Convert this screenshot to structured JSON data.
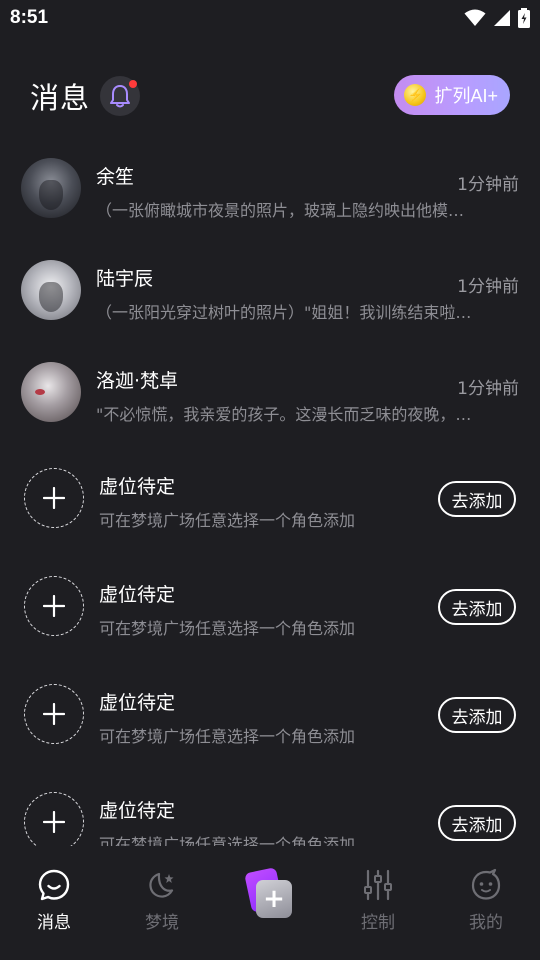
{
  "status_bar": {
    "time": "8:51"
  },
  "header": {
    "title": "消息",
    "ai_button_label": "扩列AI+"
  },
  "chats": [
    {
      "name": "余笙",
      "time": "1分钟前",
      "preview": "（一张俯瞰城市夜景的照片，玻璃上隐约映出他模…"
    },
    {
      "name": "陆宇辰",
      "time": "1分钟前",
      "preview": "（一张阳光穿过树叶的照片）\"姐姐！我训练结束啦…"
    },
    {
      "name": "洛迦·梵卓",
      "time": "1分钟前",
      "preview": "\"不必惊慌，我亲爱的孩子。这漫长而乏味的夜晚，…"
    }
  ],
  "slots": [
    {
      "title": "虚位待定",
      "desc": "可在梦境广场任意选择一个角色添加",
      "button": "去添加"
    },
    {
      "title": "虚位待定",
      "desc": "可在梦境广场任意选择一个角色添加",
      "button": "去添加"
    },
    {
      "title": "虚位待定",
      "desc": "可在梦境广场任意选择一个角色添加",
      "button": "去添加"
    },
    {
      "title": "虚位待定",
      "desc": "可在梦境广场任意选择一个角色添加",
      "button": "去添加"
    }
  ],
  "bottom_nav": {
    "items": [
      {
        "label": "消息",
        "icon": "chat-icon",
        "active": true
      },
      {
        "label": "梦境",
        "icon": "moon-star-icon",
        "active": false
      },
      {
        "label": "",
        "icon": "create-plus-icon",
        "active": false
      },
      {
        "label": "控制",
        "icon": "sliders-icon",
        "active": false
      },
      {
        "label": "我的",
        "icon": "face-icon",
        "active": false
      }
    ]
  },
  "colors": {
    "background": "#1e1e22",
    "ai_button_gradient_start": "#c48cf0",
    "ai_button_gradient_end": "#a9a6ff",
    "notification_dot": "#ff3b3b",
    "center_button_purple": "#8a2bff"
  }
}
